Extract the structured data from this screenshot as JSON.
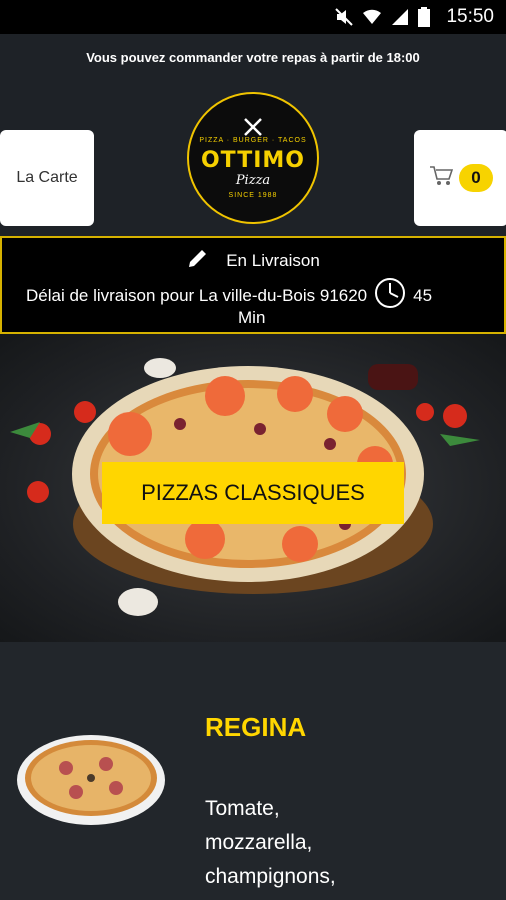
{
  "status_bar": {
    "time": "15:50"
  },
  "notice": "Vous pouvez commander votre repas à partir de 18:00",
  "header": {
    "menu_label": "La Carte",
    "cart_count": "0",
    "logo": {
      "name": "OTTIMO",
      "sub": "Pizza",
      "top_text": "PIZZA · BURGER · TACOS",
      "since": "SINCE 1988"
    }
  },
  "delivery": {
    "mode": "En Livraison",
    "line": "Délai de livraison pour La ville-du-Bois 91620",
    "time_value": "45",
    "time_unit": "Min"
  },
  "category": {
    "title": "PIZZAS CLASSIQUES"
  },
  "product": {
    "name": "REGINA",
    "description_lines": [
      "Tomate,",
      "mozzarella,",
      "champignons,"
    ]
  },
  "colors": {
    "accent": "#ffd600",
    "background": "#1e2227"
  }
}
